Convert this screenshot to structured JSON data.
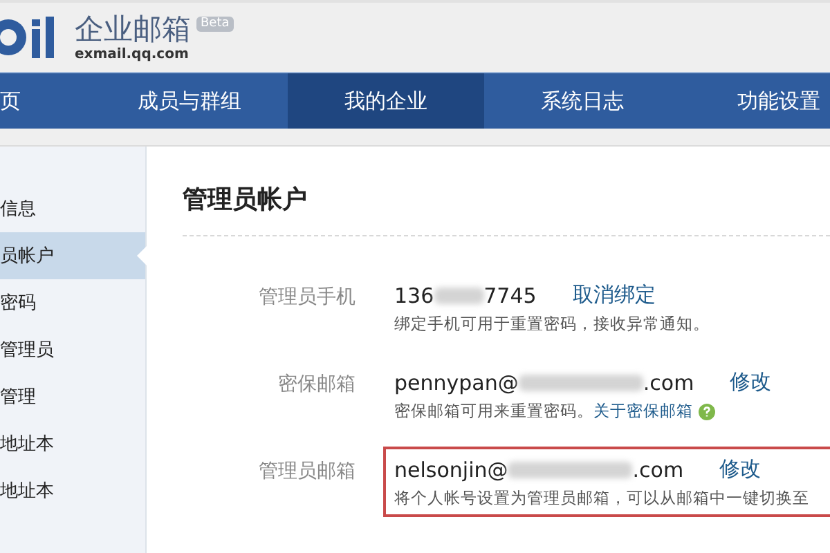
{
  "header": {
    "product_name": "企业邮箱",
    "badge": "Beta",
    "domain": "exmail.qq.com"
  },
  "nav": [
    {
      "label": "页",
      "selected": false
    },
    {
      "label": "成员与群组",
      "selected": false
    },
    {
      "label": "我的企业",
      "selected": true
    },
    {
      "label": "系统日志",
      "selected": false
    },
    {
      "label": "功能设置",
      "selected": false
    }
  ],
  "sidebar": [
    {
      "label": "信息",
      "selected": false
    },
    {
      "label": "员帐户",
      "selected": true
    },
    {
      "label": "密码",
      "selected": false
    },
    {
      "label": "管理员",
      "selected": false
    },
    {
      "label": "管理",
      "selected": false
    },
    {
      "label": "地址本",
      "selected": false
    },
    {
      "label": "地址本",
      "selected": false
    }
  ],
  "content": {
    "title": "管理员帐户",
    "rows": [
      {
        "label": "管理员手机",
        "value_start": "136",
        "value_end": "7745",
        "action": "取消绑定",
        "hint": "绑定手机可用于重置密码，接收异常通知。",
        "highlighted": false
      },
      {
        "label": "密保邮箱",
        "value_start": "pennypan@",
        "value_end": ".com",
        "action": "修改",
        "hint": "密保邮箱可用来重置密码。",
        "hint_link": "关于密保邮箱",
        "help": true,
        "highlighted": false
      },
      {
        "label": "管理员邮箱",
        "value_start": "nelsonjin@",
        "value_end": ".com",
        "action": "修改",
        "hint": "将个人帐号设置为管理员邮箱，可以从邮箱中一键切换至",
        "highlighted": true
      }
    ]
  }
}
